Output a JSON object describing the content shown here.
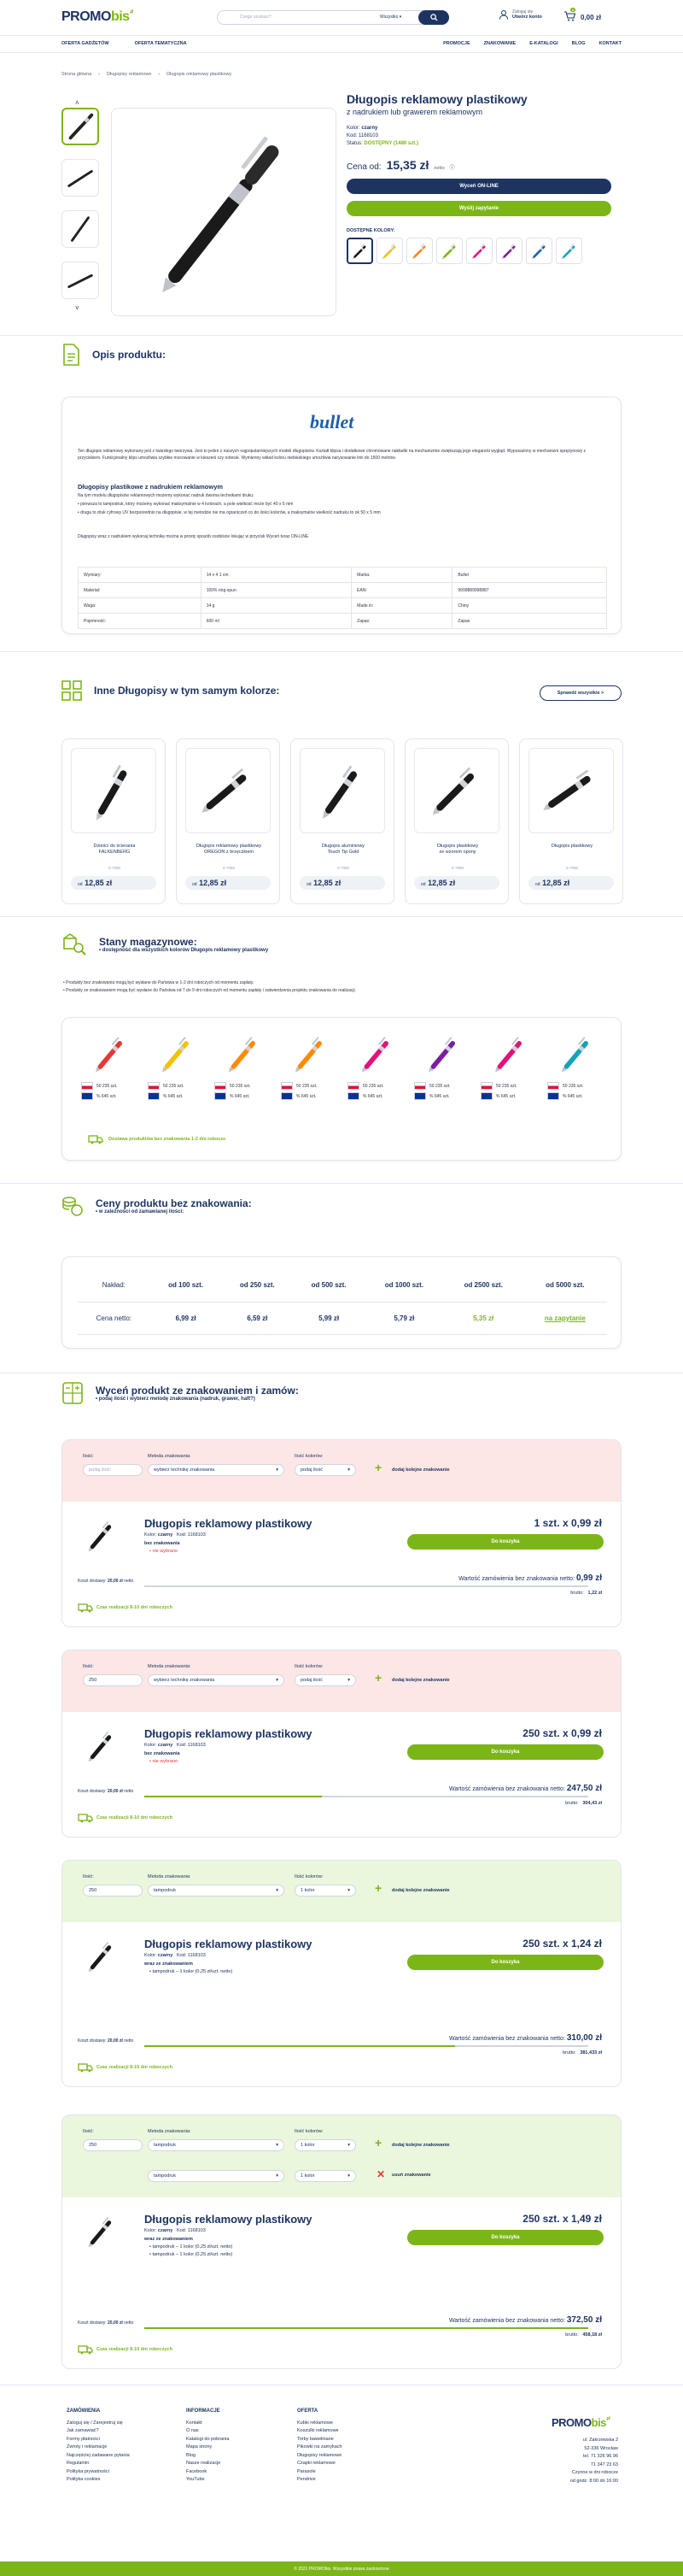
{
  "header": {
    "logo_main": "PROMO",
    "logo_accent": "bis",
    "logo_tld": ".pl",
    "search_placeholder": "Czego szukasz?",
    "search_category": "Wszystko",
    "account_line1": "Zaloguj się",
    "account_line2": "Utwórz konto",
    "cart_total": "0,00 zł",
    "cart_count": "0"
  },
  "nav": {
    "left": [
      "OFERTA GADŻETÓW",
      "OFERTA TEMATYCZNA"
    ],
    "right": [
      "PROMOCJE",
      "ZNAKOWANIE",
      "E-KATALOGI",
      "BLOG",
      "KONTAKT"
    ]
  },
  "breadcrumb": [
    "Strona główna",
    "Długopisy reklamowe",
    "Długopis reklamowy plastikowy"
  ],
  "product": {
    "title": "Długopis reklamowy plastikowy",
    "subtitle": "z nadrukiem lub grawerem reklamowym",
    "color_label": "Kolor:",
    "color_value": "czarny",
    "code_label": "Kod:",
    "code_value": "1168103",
    "status_label": "Status:",
    "status_value": "DOSTĘPNY (1480 szt.)",
    "price_label": "Cena od:",
    "price_value": "15,35 zł",
    "price_net": "netto",
    "btn_online": "Wyceń ON-LINE",
    "btn_query": "Wyślij zapytanie",
    "colors_label": "DOSTĘPNE KOLORY:",
    "swatches": [
      "#1a1a1a",
      "#f2c200",
      "#ff8a00",
      "#7cb518",
      "#e2127a",
      "#7a1fa2",
      "#1d5faa",
      "#17a2b8"
    ]
  },
  "description": {
    "title": "Opis produktu:",
    "brand": "bullet",
    "p1": "Ten długopis reklamowy wykonany jest z twardego tworzywa. Jest to jeden z naszych najpopularniejszych modeli długopisów. Kształt klipsa i dodatkowe chromowane nakładki na mechanizmie zwiększają jego elegancki wygląd. Wyposażony w mechanizm sprężynowy z przyciskiem. Funkcjonalny klips umożliwia szybkie mocowanie w kieszeni czy notesie. Wymienny wkład koloru niebieskiego umożliwia narysowanie linii do 1500 metrów.",
    "h2": "Długopisy plastikowe z nadrukiem reklamowym",
    "p2": "Na tym modelu długopisów reklamowych możemy wykonać nadruk dwoma technikami druku:",
    "b1": "• pierwsza to tampodruk, który możemy wykonać maksymalnie w 4 kolorach, a pole wielkość może być 40 x 6 mm",
    "b2": "• druga to druk cyfrowy UV bezpośrednio na długopisie, w tej metodzie nie ma ograniczeń co do ilości kolorów, a maksymalne wielkość nadruku to ok 50 x 5 mm",
    "p3": "Długopisy wraz z nadrukiem wykonaj technikę można w prosty sposób osobiście lokując w przycisk Wyceń teraz ON-LINE",
    "specs": [
      [
        "Wymiary:",
        "14 x 4 1 cm",
        "Marka:",
        "Bullet"
      ],
      [
        "Materiał:",
        "100% ring-spun",
        "EAN:",
        "9999889998887"
      ],
      [
        "Waga:",
        "14 g",
        "Made in:",
        "Chiny"
      ],
      [
        "Pojemność:",
        "600 ml",
        "Zapas:",
        "Zapas"
      ]
    ]
  },
  "similar": {
    "title": "Inne Długopisy w tym samym kolorze:",
    "btn": "Sprawdź wszystkie >",
    "items": [
      {
        "name": "Dzieści do ścierania\nFALKENBERG",
        "code": "0-7080",
        "price": "od",
        "price_val": "12,85 zł"
      },
      {
        "name": "Długopis reklamowy plastikowy\nOREGON z brzęczkiem",
        "code": "0-7080",
        "price": "od",
        "price_val": "12,85 zł"
      },
      {
        "name": "Długopis aluminiowy\nTouch Tip Gold",
        "code": "0-7080",
        "price": "od",
        "price_val": "12,85 zł"
      },
      {
        "name": "Długopis plastikowy\nze wzorem opony",
        "code": "0-7080",
        "price": "od",
        "price_val": "12,85 zł"
      },
      {
        "name": "Długopis plastikowy\n ",
        "code": "0-7080",
        "price": "od",
        "price_val": "12,85 zł"
      }
    ]
  },
  "stock": {
    "title": "Stany magazynowe:",
    "sub": "dostępność dla wszystkich kolorów Długopis reklamowy plastikowy",
    "note1": "• Produkty bez znakowania mogą być wysłane do Państwa w 1-2 dni roboczych od momentu zapłaty.",
    "note2": "• Produkty ze znakowaniem mogą być wysłane do Państwa od 7 do 9 dni roboczych od momentu zapłaty i zatwierdzenia projektu znakowania do realizacji.",
    "pl": "50 235 szt.",
    "eu": "% 645 szt.",
    "colors": [
      "#e53935",
      "#f2c200",
      "#ff8a00",
      "#ff8a00",
      "#e2127a",
      "#7a1fa2",
      "#e2127a",
      "#17a2b8"
    ],
    "delivery": "Dostawa produktów bez znakowania 1-2 dni robocze"
  },
  "prices": {
    "title": "Ceny produktu bez znakowania:",
    "sub": "w zależności od zamawianej ilości:",
    "row1_label": "Nakład:",
    "row2_label": "Cena netto:",
    "qty": [
      "od 100 szt.",
      "od 250 szt.",
      "od 500 szt.",
      "od 1000 szt.",
      "od 2500 szt.",
      "od 5000 szt."
    ],
    "val": [
      "6,99 zł",
      "6,59 zł",
      "5,99 zł",
      "5,79 zł",
      "5,35 zł",
      "na zapytanie"
    ]
  },
  "calc": {
    "title": "Wyceń produkt ze znakowaniem i zamów:",
    "sub": "podaj ilość i wybierz metodę znakowania (nadruk, grawer, haft?)",
    "lab_qty": "Ilość:",
    "lab_method": "Metoda znakowania:",
    "lab_colors": "Ilość kolorów:",
    "add": "dodaj kolejne znakowanie",
    "remove": "usuń znakowanie",
    "p_title": "Długopis reklamowy plastikowy",
    "p_color": "Kolor:",
    "p_color_v": "czarny",
    "p_code": "Kod:",
    "p_code_v": "1168103",
    "btn": "Do koszyka",
    "kosz_label": "Koszt dostawy:",
    "kosz_val": "20,00 zł",
    "kosz_net": "netto",
    "time": "Czas realizacji 8-10 dni roboczych",
    "blocks": [
      {
        "qty": "",
        "qty_ph": "podaj ilość",
        "method": "wybierz technikę znakowania",
        "colors": "podaj ilość",
        "mark1": "bez znakowania",
        "mark2": "• nie wybrano",
        "summary": "1 szt. x 0,99 zł",
        "net_label": "Wartość zamówienia bez znakowania netto:",
        "net": "0,99 zł",
        "brut_label": "brutto:",
        "brut": "1,22 zł",
        "progress": 0.0
      },
      {
        "qty": "250",
        "qty_ph": "",
        "method": "wybierz technikę znakowania",
        "colors": "podaj ilość",
        "mark1": "bez znakowania",
        "mark2": "• nie wybrano",
        "summary": "250 szt. x 0,99 zł",
        "net_label": "Wartość zamówienia bez znakowania netto:",
        "net": "247,50 zł",
        "brut_label": "brutto:",
        "brut": "304,43 zł",
        "progress": 0.4
      },
      {
        "qty": "250",
        "qty_ph": "",
        "method": "tampodruk",
        "colors": "1 kolor",
        "mark1": "wraz ze znakowaniem",
        "mark2": "• tampodruk – 1 kolor (0,25 zł/szt. netto)",
        "summary": "250 szt. x 1,24 zł",
        "net_label": "Wartość zamówienia bez znakowania netto:",
        "net": "310,00 zł",
        "brut_label": "brutto:",
        "brut": "381,433 zł",
        "progress": 0.7
      },
      {
        "qty": "250",
        "qty_ph": "",
        "method": "tampodruk",
        "colors": "1 kolor",
        "method2": "tampodruk",
        "colors2": "1 kolor",
        "mark1": "wraz ze znakowaniem",
        "mark2": "• tampodruk – 1 kolor (0,25 zł/szt. netto)",
        "mark3": "• tampodruk – 1 kolor (0,25 zł/szt. netto)",
        "summary": "250 szt. x 1,49 zł",
        "net_label": "Wartość zamówienia bez znakowania netto:",
        "net": "372,50 zł",
        "brut_label": "brutto:",
        "brut": "458,18 zł",
        "progress": 1.0
      }
    ]
  },
  "footer": {
    "col1": {
      "title": "ZAMÓWIENIA",
      "items": [
        "Zaloguj się / Zarejestruj się",
        "Jak zamawiać?",
        "Formy płatności",
        "Zwroty i reklamacje",
        "Najczęściej zadawane pytania",
        "Regulamin",
        "Polityka prywatności",
        "Polityka cookies"
      ]
    },
    "col2": {
      "title": "INFORMACJE",
      "items": [
        "Kontakt",
        "O nas",
        "Katalogi do pobrania",
        "Mapa strony",
        "Blog",
        "Nasze realizacje",
        "Facebook",
        "YouTube"
      ]
    },
    "col3": {
      "title": "OFERTA",
      "items": [
        "Kubki reklamowe",
        "Koszulki reklamowe",
        "Torby bawełniane",
        "Pikowki na zamykach",
        "Długopisy reklamowe",
        "Czapki reklamowe",
        "Parasole",
        "Pendrive"
      ]
    },
    "contact": [
      "ul. Zakrzewska 2",
      "52-336 Wrocław",
      "tel. 71 326 96 96",
      "71 347 23 63",
      "Czynne w dni robocze",
      "od godz. 8:00 do 16:00"
    ],
    "copyright": "© 2021 PROMObis. Wszystkie prawa zastrzeżone"
  }
}
